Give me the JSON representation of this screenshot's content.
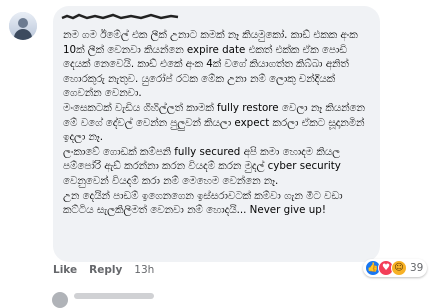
{
  "comment": {
    "text": "නම ගම ඊමේල් එක ලීක් උනාට කමක් නෑ කියමුකෝ. කාඩ් එකක අංක 10ක් ලීක් වෙනවා කියන්නෙ expire date එකත් එක්ක ඒක පොඩි දෙයක් නෙවෙයි. කාඩ් එකේ අංක 4ක් වගේ කියාගත්ත කිබ්බා අනිත් හොරකුරු නැතුව. යුරෝප් රටක මේක උනා නම් ලොකු චන්දියක් ගෙවන්න වෙනවා.\nමංසෙකටක් වැඩිය ගිහිල්ලත් කාමක් fully restore වෙලා නෑ කියන්නෙ මේ වගේ දේවල් වෙන්න පුලුවන් කියලා expect කරලා ඒකට සූදානමින් ඉදලා නෑ.\nලංකාවේ ගොඩක් කම්පනි fully secured අපි කමා හොදම කියල පම්පෝරි ඇඩ් කරන්නා කරන වියදම් කරන මුදල් cyber security වෙනුවෙන් වියදම් කරා නම් මෙහෙම වෙන්නෙ නෑ.\nඋන දෙයින් පාඩම් ඉගෙනගෙන ඉස්සරාවටක් කම්වා ගැන මීට වඩා කට්ටිය සැලකිලිමත් වෙනවා නම් හොදයි... Never give up!"
  },
  "reactions": {
    "count": "39",
    "icons": [
      "like-icon",
      "love-icon",
      "care-icon"
    ]
  },
  "actions": {
    "like": "Like",
    "reply": "Reply",
    "time": "13h"
  },
  "colors": {
    "bubble": "#f0f2f5",
    "like": "#1877f2",
    "love": "#f33e58",
    "care": "#f7b125"
  }
}
